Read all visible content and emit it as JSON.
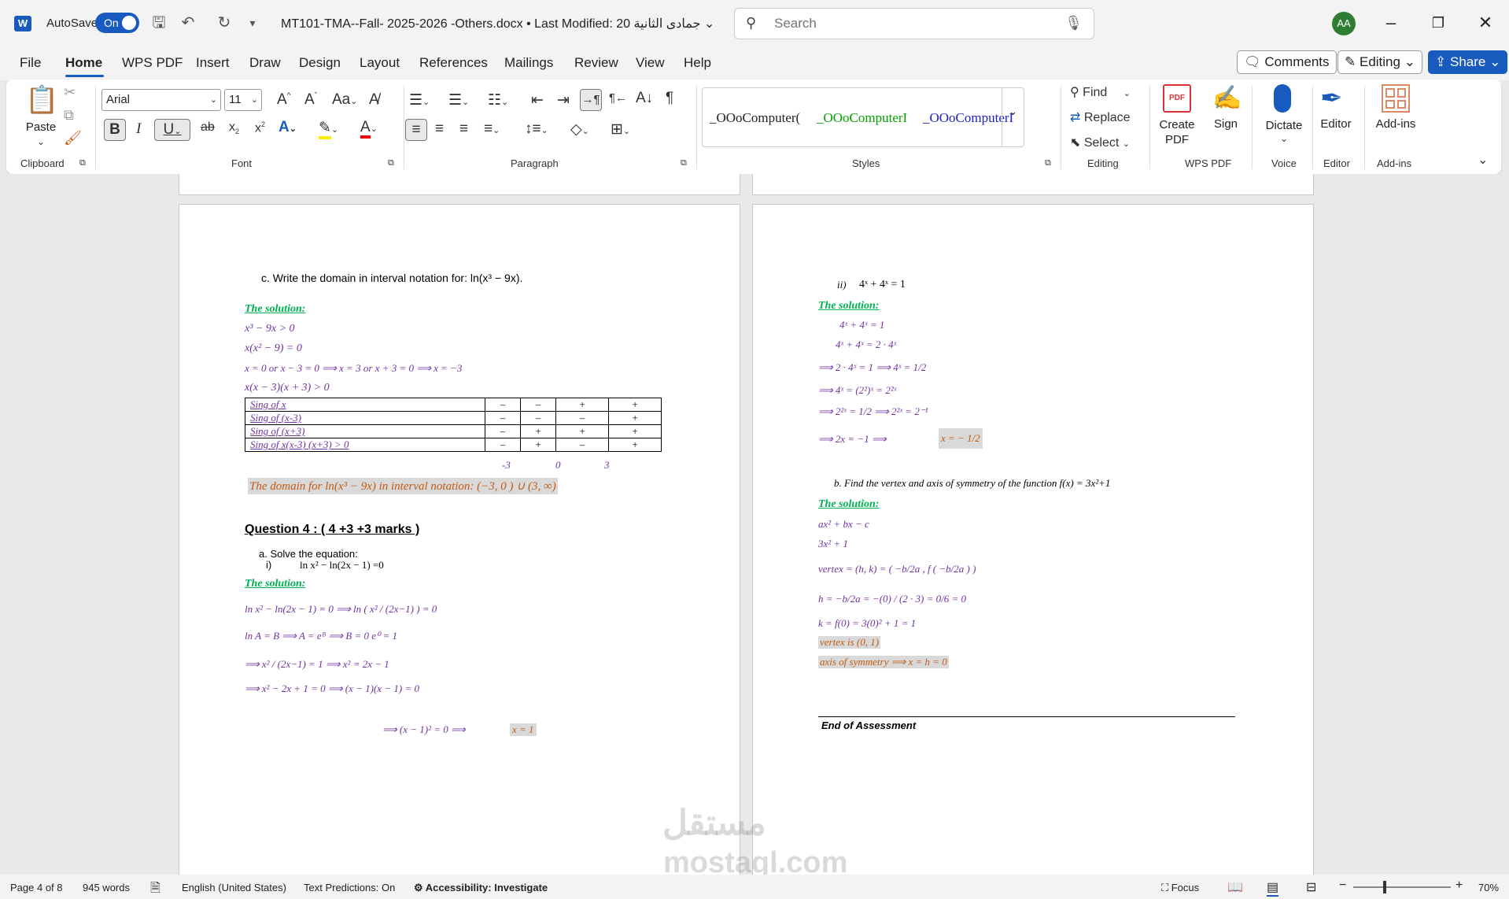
{
  "titlebar": {
    "autosave_label": "AutoSave",
    "autosave_state": "On",
    "doc_title": "MT101-TMA--Fall- 2025-2026 -Others.docx • Last Modified: 20 جمادى الثانية",
    "search_placeholder": "Search",
    "avatar_initials": "AA"
  },
  "menu": {
    "items": [
      "File",
      "Home",
      "WPS PDF",
      "Insert",
      "Draw",
      "Design",
      "Layout",
      "References",
      "Mailings",
      "Review",
      "View",
      "Help"
    ],
    "active": "Home",
    "comments_label": "Comments",
    "editing_label": "Editing",
    "share_label": "Share"
  },
  "ribbon": {
    "paste_label": "Paste",
    "clipboard_label": "Clipboard",
    "font_name": "Arial",
    "font_size": "11",
    "font_label": "Font",
    "paragraph_label": "Paragraph",
    "styles_label": "Styles",
    "style_items": [
      "_OOoComputer(",
      "_OOoComputerI",
      "_OOoComputerI"
    ],
    "style_colors": [
      "#222222",
      "#00a000",
      "#2020c0"
    ],
    "find_label": "Find",
    "replace_label": "Replace",
    "select_label": "Select",
    "editing_label": "Editing",
    "create_pdf_label": "Create PDF",
    "sign_label": "Sign",
    "wps_pdf_label": "WPS PDF",
    "dictate_label": "Dictate",
    "voice_label": "Voice",
    "editor_label": "Editor",
    "editor_group_label": "Editor",
    "addins_label": "Add-ins",
    "addins_group_label": "Add-ins"
  },
  "left_page": {
    "q_c": "c.   Write the domain in interval notation for:  ln(x³ − 9x).",
    "solution_label": "The solution:",
    "lines_c": [
      "x³  − 9x > 0",
      "x(x²  − 9) = 0",
      "x = 0     or     x − 3 = 0   ⟹    x = 3     or       x + 3 = 0 ⟹    x = −3",
      "x(x − 3)(x + 3) > 0"
    ],
    "sign_table": {
      "rows": [
        {
          "label": "Sing of  x",
          "values": [
            "–",
            "–",
            "+",
            "+"
          ]
        },
        {
          "label": "Sing of (x-3)",
          "values": [
            "–",
            "–",
            "–",
            "+"
          ]
        },
        {
          "label": "Sing of (x+3)",
          "values": [
            "–",
            "+",
            "+",
            "+"
          ]
        },
        {
          "label": "Sing of x(x-3) (x+3) > 0",
          "values": [
            "–",
            "+",
            "–",
            "+"
          ]
        }
      ],
      "boundaries": [
        "-3",
        "0",
        "3"
      ]
    },
    "domain_answer": "The domain for ln(x³ − 9x)  in interval notation: (−3, 0 )  ∪  (3, ∞)",
    "q4_heading": "Question 4 : ( 4 +3 +3 marks )",
    "q4a": "a.  Solve the equation:",
    "q4a_i_num": "i)",
    "q4a_i_eq": "ln x² − ln(2x − 1) =0",
    "lines_4a": [
      "ln x² − ln(2x − 1) = 0   ⟹    ln ( x² / (2x−1) ) = 0",
      "ln  A = B    ⟹     A = eᴮ    ⟹    B = 0        e⁰  = 1",
      "⟹   x² / (2x−1)   =  1 ⟹  x² = 2x − 1",
      "⟹    x² − 2x + 1 = 0    ⟹   (x − 1)(x − 1) = 0"
    ],
    "final_left": "⟹   (x − 1)²  = 0     ⟹",
    "final_answer": "x = 1"
  },
  "right_page": {
    "q_ii_num": "ii)",
    "q_ii_eq": "4ˣ + 4ˣ = 1",
    "solution_label": "The solution:",
    "lines_ii": [
      "4ˣ + 4ˣ = 1",
      "4ˣ + 4ˣ =  2 · 4ˣ",
      "⟹  2 · 4ˣ = 1   ⟹   4ˣ = 1/2",
      "⟹  4ˣ = (2²)ˣ = 2²ˣ",
      "⟹  2²ˣ = 1/2    ⟹   2²ˣ  =  2⁻¹",
      "⟹    2x = −1        ⟹"
    ],
    "answer_ii": "x = − 1/2",
    "q_b": "b. Find the vertex  and axis of symmetry of the function f(x) = 3x²+1",
    "lines_b": [
      "ax² + bx − c",
      "3x² + 1",
      "vertex = (h, k) = ( −b/2a , f ( −b/2a ) )",
      "h = −b/2a  =  −(0) / (2 · 3)  =  0/6  = 0",
      "k = f(0) = 3(0)² + 1 = 1"
    ],
    "vertex_answer": "vertex  is (0, 1)",
    "axis_answer": "axis  of  symmetry   ⟹ x = h = 0",
    "end_text": "End of Assessment"
  },
  "statusbar": {
    "page": "Page 4 of 8",
    "words": "945 words",
    "language": "English (United States)",
    "predictions": "Text Predictions: On",
    "accessibility": "Accessibility: Investigate",
    "focus": "Focus",
    "zoom": "70%"
  },
  "watermark": {
    "arabic": "مستقل",
    "latin": "mostaql.com"
  }
}
